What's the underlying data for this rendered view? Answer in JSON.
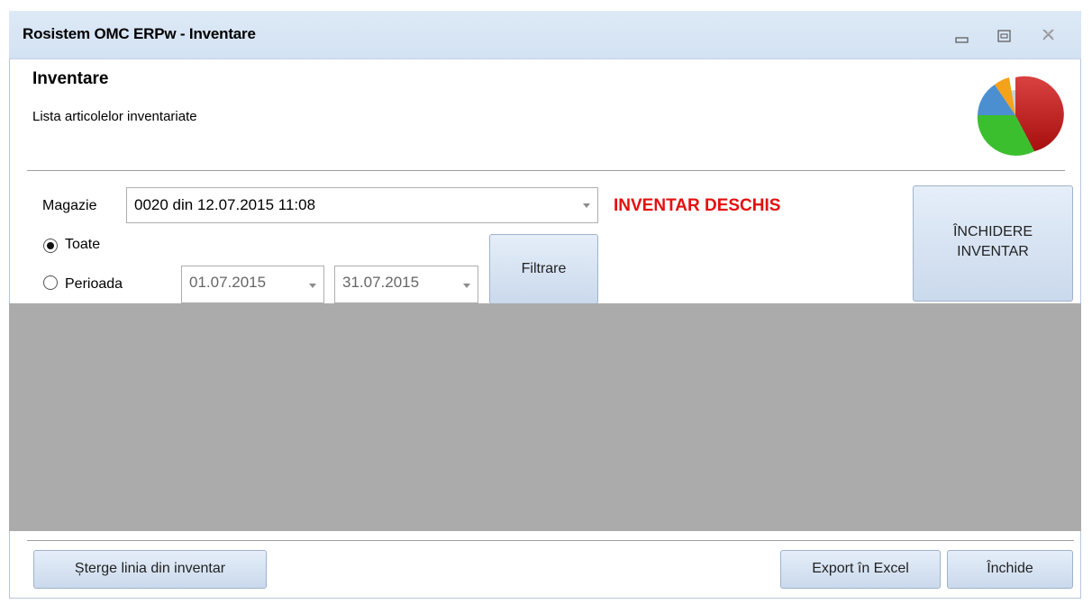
{
  "window": {
    "title": "Rosistem OMC ERPw - Inventare",
    "controls": [
      "minimize-icon",
      "maximize-icon",
      "close-icon"
    ]
  },
  "header": {
    "title": "Inventare",
    "subtitle": "Lista articolelor inventariate",
    "logo_icon": "pie-chart-icon"
  },
  "filter": {
    "magazie_label": "Magazie",
    "magazie_value": "0020 din 12.07.2015 11:08",
    "status_text": "INVENTAR DESCHIS",
    "status_color": "#e40f0f",
    "radio_all_label": "Toate",
    "radio_all_checked": true,
    "radio_period_label": "Perioada",
    "radio_period_checked": false,
    "date_from": "01.07.2015",
    "date_to": "31.07.2015",
    "filter_button": "Filtrare",
    "close_inventory_button": [
      "ÎNCHIDERE",
      "INVENTAR"
    ]
  },
  "footer": {
    "delete_line_button": "Șterge linia din inventar",
    "export_button": "Export în Excel",
    "close_button": "Închide"
  },
  "colors": {
    "titlebar": "#d8e6f5",
    "grid_background": "#ababab",
    "button_gradient_top": "#e5eef9",
    "button_gradient_bottom": "#cad9ec"
  }
}
